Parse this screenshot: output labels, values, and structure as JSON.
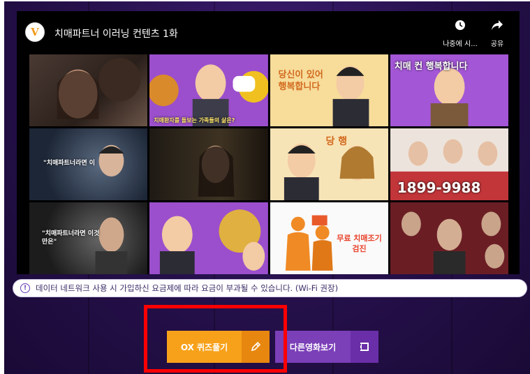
{
  "player": {
    "title": "치매파트너 이러닝 컨텐츠 1화",
    "watch_later_label": "나중에 시...",
    "share_label": "공유",
    "channel_logo_text": "V"
  },
  "thumbnails": [
    {
      "caption": ""
    },
    {
      "caption": "치매환자를 돌보는 가족들의 삶은?"
    },
    {
      "caption": "당신이 있어 행복합니다"
    },
    {
      "caption": "치매 컨 행복합니다"
    },
    {
      "caption": "\"치매파트너라면 이"
    },
    {
      "caption": ""
    },
    {
      "caption": "당 행"
    },
    {
      "caption": "1899-9988"
    },
    {
      "caption": "\"치매파트너라면 이것만은\""
    },
    {
      "caption": ""
    },
    {
      "caption": "무료 치매조기검진"
    },
    {
      "caption": ""
    }
  ],
  "notice": {
    "text": "데이터 네트워크 사용 시 가입하신 요금제에 따라 요금이 부과될 수 있습니다. (Wi-Fi 권장)"
  },
  "buttons": {
    "quiz_label": "OX 퀴즈풀기",
    "video_label": "다른영화보기"
  },
  "colors": {
    "quiz_orange": "#f7a11a",
    "video_purple": "#7b3fb8",
    "highlight_red": "#ff0000"
  }
}
